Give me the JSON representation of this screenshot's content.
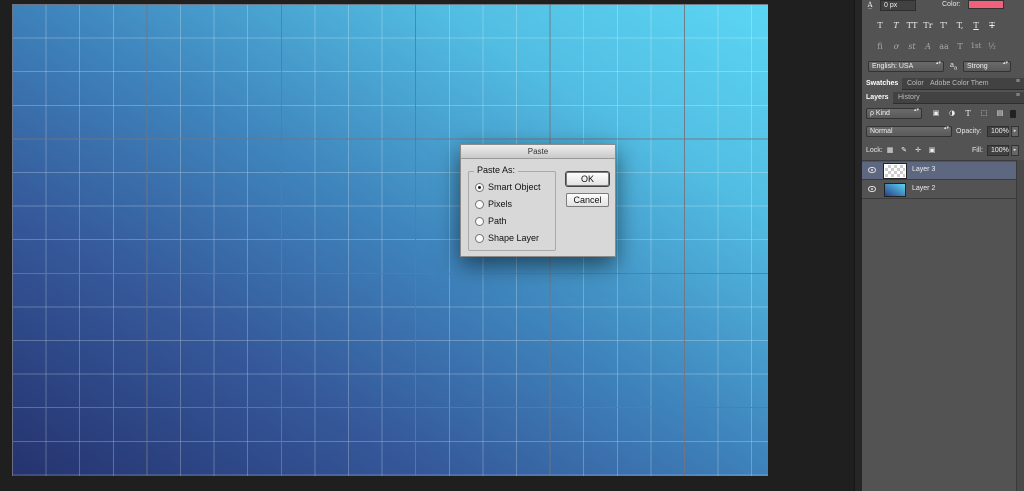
{
  "canvas": {
    "gradient_colors": [
      "#25336e",
      "#3f85bd",
      "#5bd6f4"
    ],
    "guides": "on"
  },
  "dialog": {
    "title": "Paste",
    "group_label": "Paste As:",
    "options": [
      {
        "label": "Smart Object",
        "selected": true
      },
      {
        "label": "Pixels",
        "selected": false
      },
      {
        "label": "Path",
        "selected": false
      },
      {
        "label": "Shape Layer",
        "selected": false
      }
    ],
    "ok_label": "OK",
    "cancel_label": "Cancel"
  },
  "character_panel": {
    "tracking_icon": "A-tracking-icon",
    "baseline_value": "0 px",
    "color_label": "Color:",
    "color_value": "#f2607c",
    "style_buttons_row1": [
      "T",
      "T",
      "TT",
      "Tr",
      "T'",
      "T,",
      "T",
      "T"
    ],
    "style_buttons_row2": [
      "fi",
      "ơ",
      "st",
      "A",
      "aa",
      "T",
      "1st",
      "½"
    ],
    "language": "English: USA",
    "aa_icon": "a",
    "aa_icon_b": "a",
    "antialias": "Strong"
  },
  "swatches_tabs": [
    "Swatches",
    "Color",
    "Adobe Color Them"
  ],
  "layers_panel": {
    "tabs": [
      "Layers",
      "History"
    ],
    "filter": "ρ Kind",
    "blend_mode": "Normal",
    "opacity_label": "Opacity:",
    "opacity_value": "100%",
    "lock_label": "Lock:",
    "fill_label": "Fill:",
    "fill_value": "100%",
    "layers": [
      {
        "name": "Layer 3",
        "selected": true,
        "visible": true,
        "thumbnail": "transparent"
      },
      {
        "name": "Layer 2",
        "selected": false,
        "visible": true,
        "thumbnail": "gradient"
      }
    ]
  },
  "colors": {
    "accent_selection": "#5e6780",
    "panel_bg": "#535353"
  }
}
